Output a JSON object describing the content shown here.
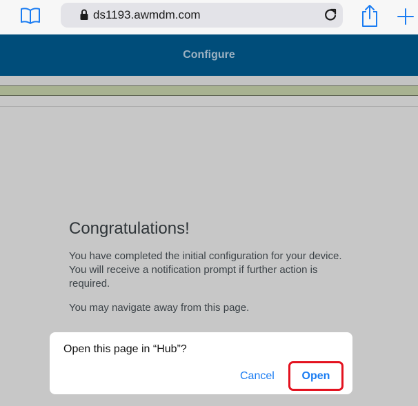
{
  "browser": {
    "url": "ds1193.awmdm.com",
    "icons": {
      "bookmarks": "book-icon",
      "lock": "lock-icon",
      "reload": "reload-icon",
      "share": "share-icon",
      "new_tab": "plus-icon"
    },
    "accent_color": "#1a7cf2"
  },
  "page": {
    "header_title": "Configure",
    "header_color": "#004d7a",
    "congrats_title": "Congratulations!",
    "congrats_body": "You have completed the initial configuration for your device. You will receive a notification prompt if further action is required.",
    "navigate_text": "You may navigate away from this page."
  },
  "dialog": {
    "message": "Open this page in “Hub”?",
    "cancel_label": "Cancel",
    "open_label": "Open",
    "highlight_color": "#e3121f"
  }
}
